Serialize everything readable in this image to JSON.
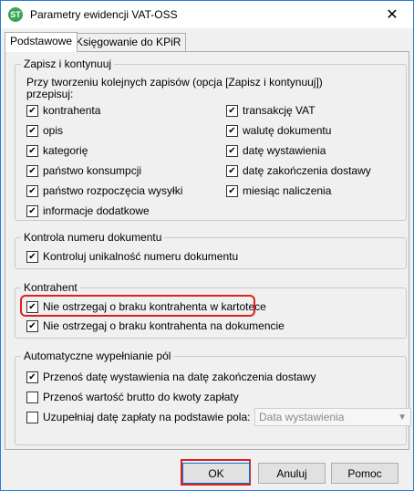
{
  "window": {
    "title": "Parametry ewidencji VAT-OSS",
    "icon": "app-icon",
    "close_label": "✕"
  },
  "tabs": [
    {
      "label": "Podstawowe",
      "active": true
    },
    {
      "label": "Księgowanie do KPiR",
      "active": false
    }
  ],
  "group_zapisz": {
    "legend": "Zapisz i kontynuuj",
    "description": "Przy tworzeniu kolejnych zapisów (opcja [Zapisz i kontynuuj]) przepisuj:",
    "left": [
      {
        "label": "kontrahenta",
        "checked": true
      },
      {
        "label": "opis",
        "checked": true
      },
      {
        "label": "kategorię",
        "checked": true
      },
      {
        "label": "państwo konsumpcji",
        "checked": true
      },
      {
        "label": "państwo rozpoczęcia wysyłki",
        "checked": true
      },
      {
        "label": "informacje dodatkowe",
        "checked": true
      }
    ],
    "right": [
      {
        "label": "transakcję VAT",
        "checked": true
      },
      {
        "label": "walutę dokumentu",
        "checked": true
      },
      {
        "label": "datę wystawienia",
        "checked": true
      },
      {
        "label": "datę zakończenia dostawy",
        "checked": true
      },
      {
        "label": "miesiąc naliczenia",
        "checked": true
      }
    ]
  },
  "group_kontrola": {
    "legend": "Kontrola numeru dokumentu",
    "item": {
      "label": "Kontroluj unikalność numeru dokumentu",
      "checked": true
    }
  },
  "group_kontrahent": {
    "legend": "Kontrahent",
    "items": [
      {
        "label": "Nie ostrzegaj o braku kontrahenta w kartotece",
        "checked": true
      },
      {
        "label": "Nie ostrzegaj o braku kontrahenta na dokumencie",
        "checked": true
      }
    ]
  },
  "group_auto": {
    "legend": "Automatyczne wypełnianie pól",
    "items": [
      {
        "label": "Przenoś datę wystawienia na datę zakończenia dostawy",
        "checked": true
      },
      {
        "label": "Przenoś wartość brutto do kwoty zapłaty",
        "checked": false
      },
      {
        "label": "Uzupełniaj datę zapłaty na podstawie pola:",
        "checked": false
      }
    ],
    "combo_value": "Data wystawienia"
  },
  "buttons": {
    "ok": "OK",
    "cancel": "Anuluj",
    "help": "Pomoc"
  }
}
